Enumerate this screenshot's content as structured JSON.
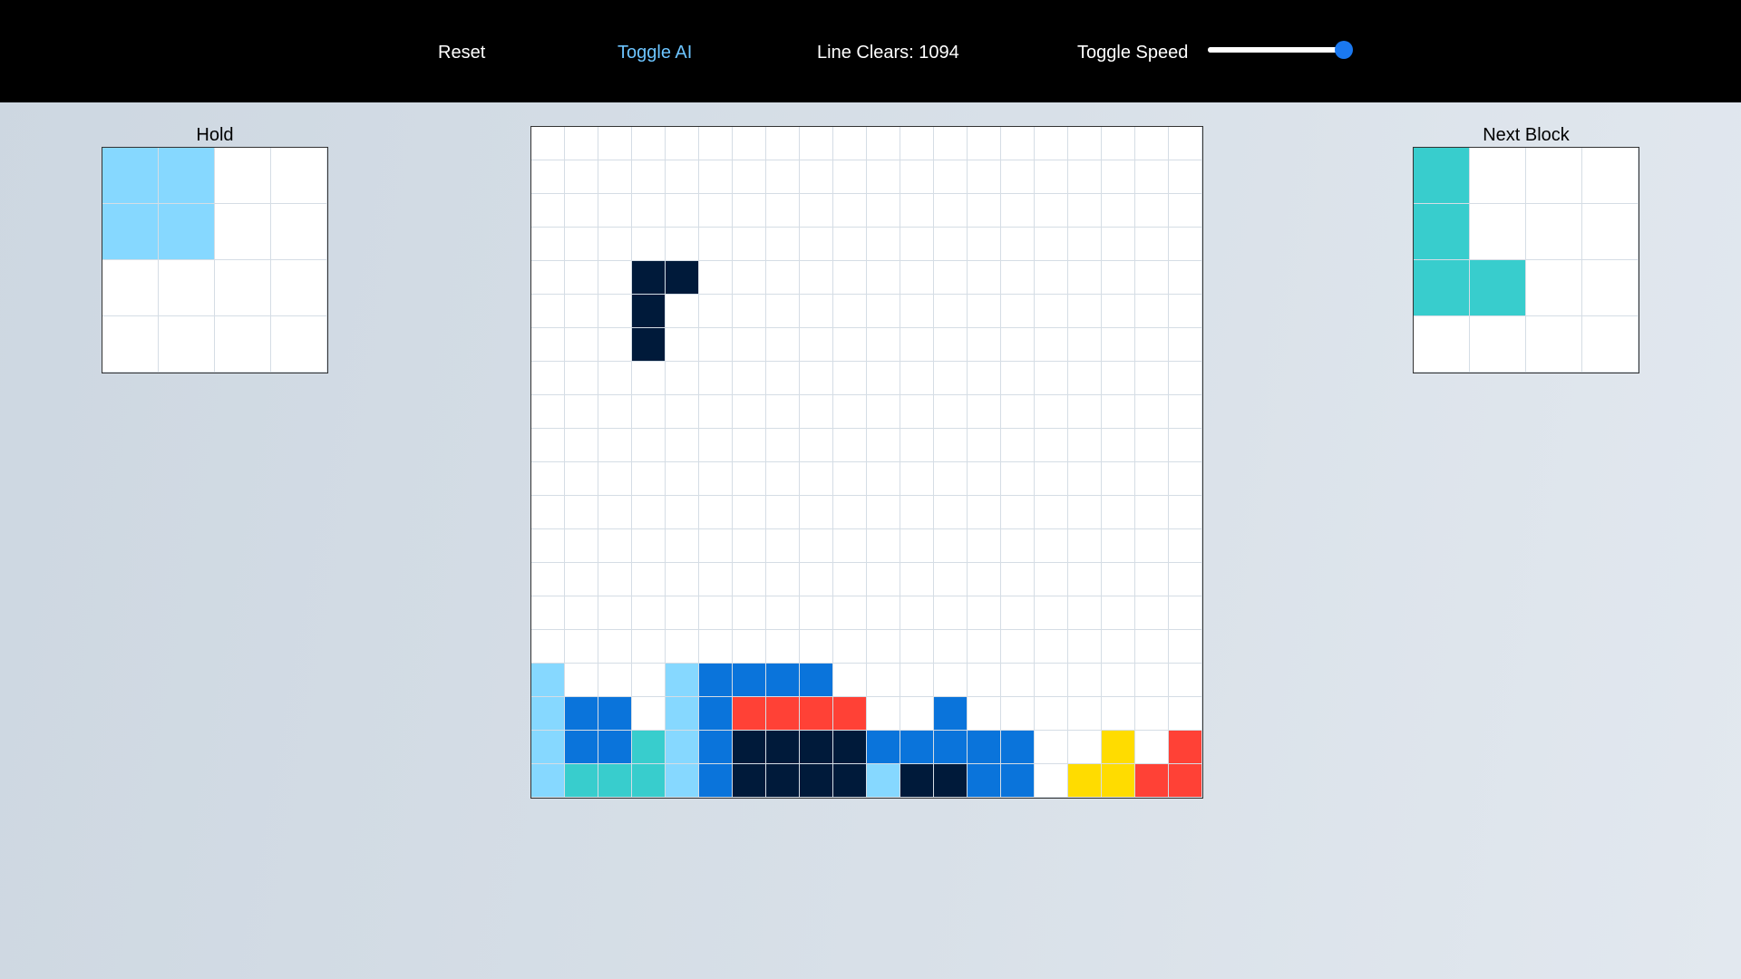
{
  "toolbar": {
    "reset_label": "Reset",
    "ai_label": "Toggle AI",
    "line_clears_label": "Line Clears: 1094",
    "speed_label": "Toggle Speed",
    "speed_value": 1.0
  },
  "hold": {
    "title": "Hold",
    "rows": [
      "LL..",
      "LL..",
      "....",
      "...."
    ]
  },
  "next": {
    "title": "Next Block",
    "rows": [
      "C...",
      "C...",
      "CC..",
      "...."
    ]
  },
  "board": {
    "rows": [
      "....................",
      "....................",
      "....................",
      "....................",
      "...NN...............",
      "...N................",
      "...N................",
      "....................",
      "....................",
      "....................",
      "....................",
      "....................",
      "....................",
      "....................",
      "....................",
      "....................",
      "L...LBBBB...........",
      "LBB.LBRRRR..B.......",
      "LBBCLBNNNNBBBBB..Y.R",
      "LCCCLBNNNNLNNBB.YYRR"
    ]
  },
  "colors": {
    "L": "#86d8ff",
    "B": "#0a74db",
    "N": "#001a3a",
    "C": "#38cdcd",
    "R": "#ff4136",
    "Y": "#ffdc00",
    "empty": "#ffffff",
    "topbar": "#000000",
    "accent": "#1a78f0"
  }
}
